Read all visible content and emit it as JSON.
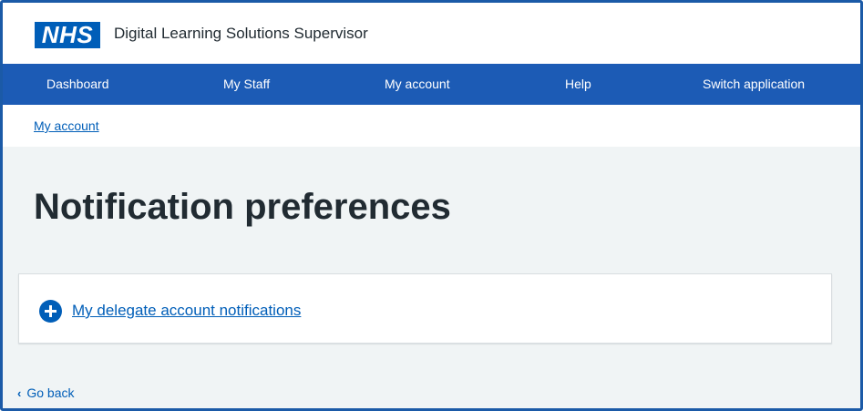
{
  "header": {
    "logo_text": "NHS",
    "service_name": "Digital Learning Solutions Supervisor"
  },
  "nav": {
    "items": [
      {
        "label": "Dashboard"
      },
      {
        "label": "My Staff"
      },
      {
        "label": "My account"
      },
      {
        "label": "Help"
      },
      {
        "label": "Switch application"
      }
    ]
  },
  "breadcrumb": {
    "label": "My account"
  },
  "main": {
    "title": "Notification preferences",
    "details": {
      "summary": "My delegate account notifications",
      "icon": "plus-circle-icon",
      "expanded": false
    }
  },
  "footer": {
    "back_label": "Go back",
    "back_icon": "chevron-left-icon"
  },
  "colors": {
    "brand_blue": "#005eb8",
    "nav_blue": "#1c5bb5",
    "page_background": "#f0f4f5",
    "text": "#212b32"
  }
}
